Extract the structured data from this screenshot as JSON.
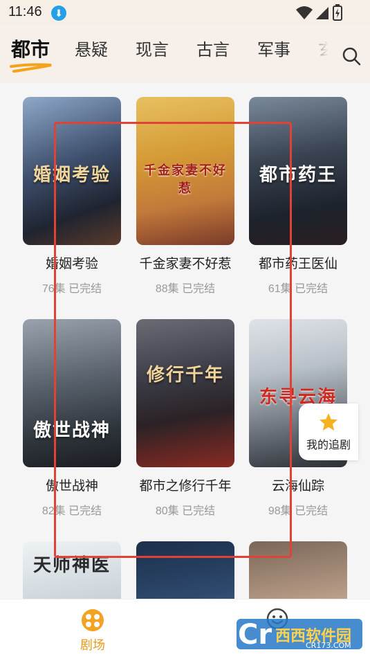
{
  "status_bar": {
    "time": "11:46"
  },
  "tabs": {
    "items": [
      "都市",
      "悬疑",
      "现言",
      "古言",
      "军事",
      "玄"
    ],
    "active_index": 0
  },
  "dramas": [
    {
      "title": "婚姻考验",
      "episodes": "76集",
      "status": "已完结",
      "poster_text": "婚姻考验"
    },
    {
      "title": "千金家妻不好惹",
      "episodes": "88集",
      "status": "已完结",
      "poster_text": "千金家妻不好惹"
    },
    {
      "title": "都市药王医仙",
      "episodes": "61集",
      "status": "已完结",
      "poster_text": "都市药王"
    },
    {
      "title": "傲世战神",
      "episodes": "82集",
      "status": "已完结",
      "poster_text": "傲世战神"
    },
    {
      "title": "都市之修行千年",
      "episodes": "80集",
      "status": "已完结",
      "poster_text": "修行千年"
    },
    {
      "title": "云海仙踪",
      "episodes": "98集",
      "status": "已完结",
      "poster_text": "东寻云海"
    },
    {
      "title": "",
      "episodes": "",
      "status": "",
      "poster_text": "天师神医"
    },
    {
      "title": "",
      "episodes": "",
      "status": "",
      "poster_text": ""
    },
    {
      "title": "",
      "episodes": "",
      "status": "",
      "poster_text": ""
    }
  ],
  "floating_button": {
    "label": "我的追剧",
    "icon": "star-icon"
  },
  "bottom_nav": [
    {
      "label": "剧场",
      "icon": "theater-icon",
      "active": true
    },
    {
      "label": "",
      "icon": "smiley-icon",
      "active": false
    }
  ],
  "watermark": {
    "brand": "西西软件园",
    "site": "CR173.COM"
  },
  "colors": {
    "accent": "#f5a623",
    "active_nav": "#e89a1b",
    "highlight_frame": "#e04335",
    "tab_underline": "#f5a21b",
    "download_badge": "#25a0e6"
  }
}
